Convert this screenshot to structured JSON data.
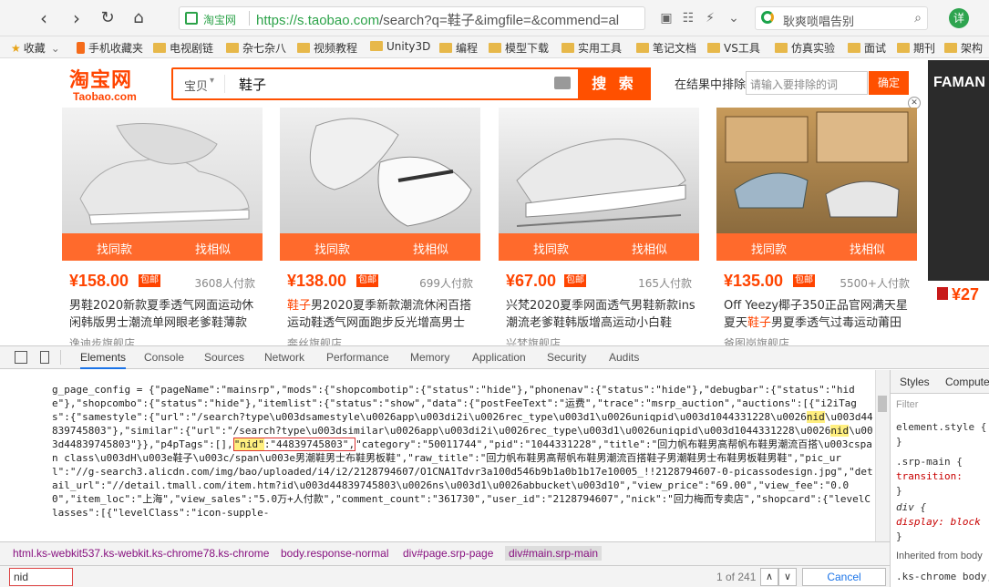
{
  "browser": {
    "site_name": "淘宝网",
    "url_host": "https://s.taobao.com",
    "url_rest": "/search?q=鞋子&imgfile=&commend=al",
    "search_hint": "耿爽唢唱告别",
    "avatar_label": "详",
    "icons": [
      "back-icon",
      "refresh-icon",
      "home-icon",
      "search-icon"
    ]
  },
  "bookmarks": [
    {
      "label": "收藏",
      "type": "star"
    },
    {
      "label": "手机收藏夹",
      "type": "phone"
    },
    {
      "label": "电视剧链",
      "type": "folder"
    },
    {
      "label": "杂七杂八",
      "type": "folder"
    },
    {
      "label": "视频教程",
      "type": "folder"
    },
    {
      "label": "Unity3D",
      "type": "folder"
    },
    {
      "label": "编程",
      "type": "folder"
    },
    {
      "label": "模型下载",
      "type": "folder"
    },
    {
      "label": "实用工具",
      "type": "folder"
    },
    {
      "label": "笔记文档",
      "type": "folder"
    },
    {
      "label": "VS工具",
      "type": "folder"
    },
    {
      "label": "仿真实验",
      "type": "folder"
    },
    {
      "label": "面试",
      "type": "folder"
    },
    {
      "label": "期刊",
      "type": "folder"
    },
    {
      "label": "架构",
      "type": "folder"
    }
  ],
  "taobao": {
    "logo_cn": "淘宝网",
    "logo_en": "Taobao.com",
    "category": "宝贝",
    "query": "鞋子",
    "search_button": "搜 索",
    "exclude_label": "在结果中排除",
    "exclude_placeholder": "请输入要排除的词",
    "confirm_button": "确定"
  },
  "products": [
    {
      "find_same": "找同款",
      "find_similar": "找相似",
      "price": "¥158.00",
      "tag": "包邮",
      "buyers": "3608人付款",
      "title_pre": "男鞋2020新款夏季透气网面运动休闲韩版男士潮流单网眼老爹鞋薄款",
      "title_hl": "",
      "title_post": "",
      "shop": "逸迪步旗舰店"
    },
    {
      "find_same": "找同款",
      "find_similar": "找相似",
      "price": "¥138.00",
      "tag": "包邮",
      "buyers": "699人付款",
      "title_pre": "",
      "title_hl": "鞋子",
      "title_post": "男2020夏季新款潮流休闲百搭运动鞋透气网面跑步反光增高男士",
      "shop": "奔丝旗舰店"
    },
    {
      "find_same": "找同款",
      "find_similar": "找相似",
      "price": "¥67.00",
      "tag": "包邮",
      "buyers": "165人付款",
      "title_pre": "兴梵2020夏季网面透气男鞋新款ins潮流老爹鞋韩版增高运动小白鞋",
      "title_hl": "",
      "title_post": "",
      "shop": "兴梵旗舰店"
    },
    {
      "find_same": "找同款",
      "find_similar": "找相似",
      "price": "¥135.00",
      "tag": "包邮",
      "buyers": "5500+人付款",
      "title_pre": "Off Yeezy椰子350正品官网满天星夏天",
      "title_hl": "鞋子",
      "title_post": "男夏季透气过毒运动莆田",
      "shop": "爸图岗旗舰店"
    }
  ],
  "side_ad": {
    "brand": "FAMAN",
    "price": "¥27"
  },
  "devtools": {
    "tabs": [
      "Elements",
      "Console",
      "Sources",
      "Network",
      "Performance",
      "Memory",
      "Application",
      "Security",
      "Audits"
    ],
    "styles_tabs": [
      "Styles",
      "Compute"
    ],
    "filter_placeholder": "Filter",
    "style_lines": [
      "element.style {",
      "}",
      ".srp-main {",
      "  transition:",
      "}",
      "div {",
      "  display: block",
      "}",
      "Inherited from body",
      ".ks-chrome body,"
    ],
    "source_text_1": "g_page_config = {\"pageName\":\"mainsrp\",\"mods\":{\"shopcombotip\":{\"status\":\"hide\"},\"phonenav\":{\"status\":\"hide\"},\"debugbar\":{\"status\":\"hide\"},\"shopcombo\":{\"status\":\"hide\"},\"itemlist\":{\"status\":\"show\",\"data\":{\"postFeeText\":\"运费\",\"trace\":\"msrp_auction\",\"auctions\":[{\"i2iTags\":{\"samestyle\":{\"url\":\"/search?type\\u003dsamestyle\\u0026app\\u003di2i\\u0026rec_type\\u003d1\\u0026uniqpid\\u003d1044331228\\u0026",
    "hl_1": "nid",
    "source_text_2": "\\u003d44839745803\"},\"similar\":{\"url\":\"/search?type\\u003dsimilar\\u0026app\\u003di2i\\u0026rec_type\\u003d1\\u0026uniqpid\\u003d1044331228\\u0026",
    "hl_2": "nid",
    "source_text_3": "\\u003d44839745803\"}},\"p4pTags\":[],",
    "hl_3": "\"nid\"",
    "boxed": ":\"44839745803\",",
    "source_text_4": "\"category\":\"50011744\",\"pid\":\"1044331228\",\"title\":\"回力帆布鞋男高帮帆布鞋男潮流百搭\\u003cspan class\\u003dH\\u003e鞋子\\u003c/span\\u003e男潮鞋男士布鞋男板鞋\",\"raw_title\":\"回力帆布鞋男高帮帆布鞋男潮流百搭鞋子男潮鞋男士布鞋男板鞋男鞋\",\"pic_url\":\"//g-search3.alicdn.com/img/bao/uploaded/i4/i2/2128794607/O1CNA1Tdvr3a100d546b9b1a0b1b17e10005_!!2128794607-0-picassodesign.jpg\",\"detail_url\":\"//detail.tmall.com/item.htm?id\\u003d44839745803\\u0026ns\\u003d1\\u0026abbucket\\u003d10\",\"view_price\":\"69.00\",\"view_fee\":\"0.00\",\"item_loc\":\"上海\",\"view_sales\":\"5.0万+人付款\",\"comment_count\":\"361730\",\"user_id\":\"2128794607\",\"nick\":\"回力梅而专卖店\",\"shopcard\":{\"levelClasses\":[{\"levelClass\":\"icon-supple-",
    "breadcrumbs": [
      "html.ks-webkit537.ks-webkit.ks-chrome78.ks-chrome",
      "body.response-normal",
      "div#page.srp-page",
      "div#main.srp-main"
    ],
    "find_value": "nid",
    "find_count": "1 of 241",
    "find_cancel": "Cancel"
  }
}
